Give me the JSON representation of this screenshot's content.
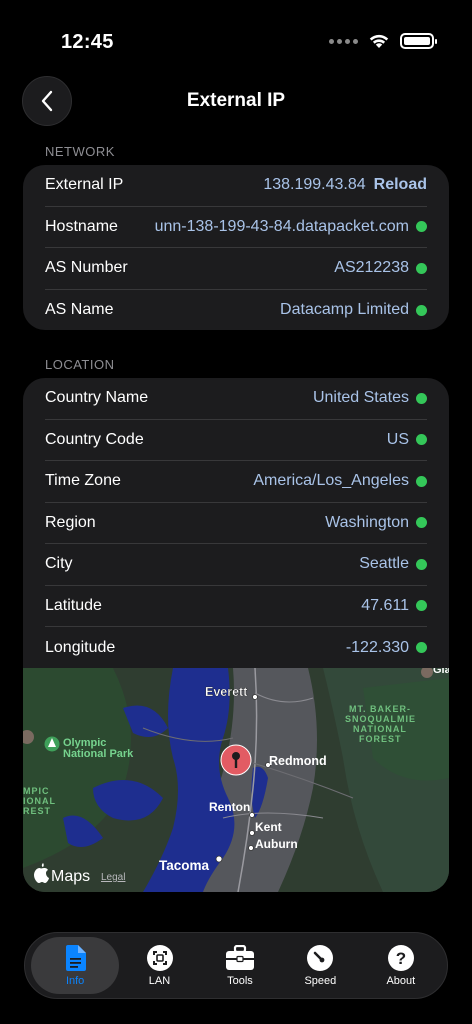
{
  "status": {
    "time": "12:45"
  },
  "nav": {
    "title": "External IP"
  },
  "network": {
    "header": "NETWORK",
    "external_ip": {
      "label": "External IP",
      "value": "138.199.43.84",
      "action": "Reload"
    },
    "rows": [
      {
        "label": "Hostname",
        "value": "unn-138-199-43-84.datapacket.com"
      },
      {
        "label": "AS Number",
        "value": "AS212238"
      },
      {
        "label": "AS Name",
        "value": "Datacamp Limited"
      }
    ]
  },
  "location": {
    "header": "LOCATION",
    "rows": [
      {
        "label": "Country Name",
        "value": "United States"
      },
      {
        "label": "Country Code",
        "value": "US"
      },
      {
        "label": "Time Zone",
        "value": "America/Los_Angeles"
      },
      {
        "label": "Region",
        "value": "Washington"
      },
      {
        "label": "City",
        "value": "Seattle"
      },
      {
        "label": "Latitude",
        "value": "47.611"
      },
      {
        "label": "Longitude",
        "value": "-122.330"
      }
    ]
  },
  "map": {
    "labels": {
      "everett": "Everett",
      "redmond": "Redmond",
      "renton": "Renton",
      "kent": "Kent",
      "auburn": "Auburn",
      "tacoma": "Tacoma",
      "olympic_1": "Olympic",
      "olympic_2": "National Park",
      "olympic_left_1": "MPIC",
      "olympic_left_2": "IONAL",
      "olympic_left_3": "REST",
      "forest_1": "MT. BAKER-",
      "forest_2": "SNOQUALMIE",
      "forest_3": "NATIONAL",
      "forest_4": "FOREST",
      "corner": "Gla",
      "brand": "Maps",
      "legal": "Legal"
    }
  },
  "tabs": [
    {
      "label": "Info",
      "icon": "document-icon",
      "active": true
    },
    {
      "label": "LAN",
      "icon": "lan-icon",
      "active": false
    },
    {
      "label": "Tools",
      "icon": "toolbox-icon",
      "active": false
    },
    {
      "label": "Speed",
      "icon": "speedometer-icon",
      "active": false
    },
    {
      "label": "About",
      "icon": "question-icon",
      "active": false
    }
  ],
  "colors": {
    "accent": "#0a84ff",
    "value_text": "#a9c3e8",
    "status_ok": "#34c759",
    "card": "#1c1c1e"
  }
}
